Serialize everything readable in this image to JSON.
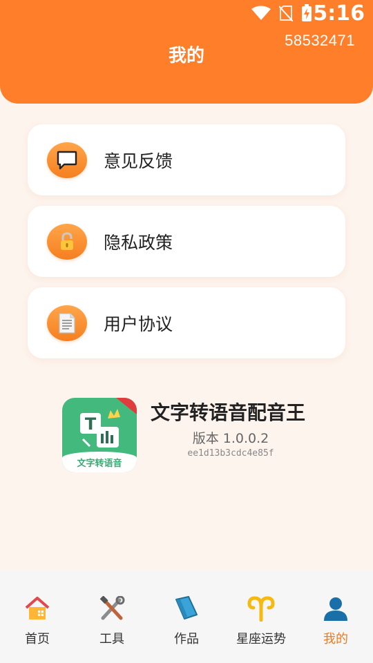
{
  "status": {
    "time": "5:16"
  },
  "header": {
    "title": "我的",
    "user_id": "58532471"
  },
  "menu": [
    {
      "label": "意见反馈",
      "icon": "chat-bubble-icon"
    },
    {
      "label": "隐私政策",
      "icon": "lock-icon"
    },
    {
      "label": "用户协议",
      "icon": "document-icon"
    }
  ],
  "app": {
    "name": "文字转语音配音王",
    "version": "版本 1.0.0.2",
    "hash": "ee1d13b3cdc4e85f",
    "logo_text": "文字转语音"
  },
  "tabs": [
    {
      "label": "首页",
      "icon": "house-icon",
      "active": false
    },
    {
      "label": "工具",
      "icon": "tools-icon",
      "active": false
    },
    {
      "label": "作品",
      "icon": "folder-icon",
      "active": false
    },
    {
      "label": "星座运势",
      "icon": "aries-icon",
      "active": false
    },
    {
      "label": "我的",
      "icon": "user-icon",
      "active": true
    }
  ],
  "colors": {
    "accent": "#ff7e2a",
    "active_tab": "#f07a1c",
    "logo_green": "#44b97e"
  }
}
